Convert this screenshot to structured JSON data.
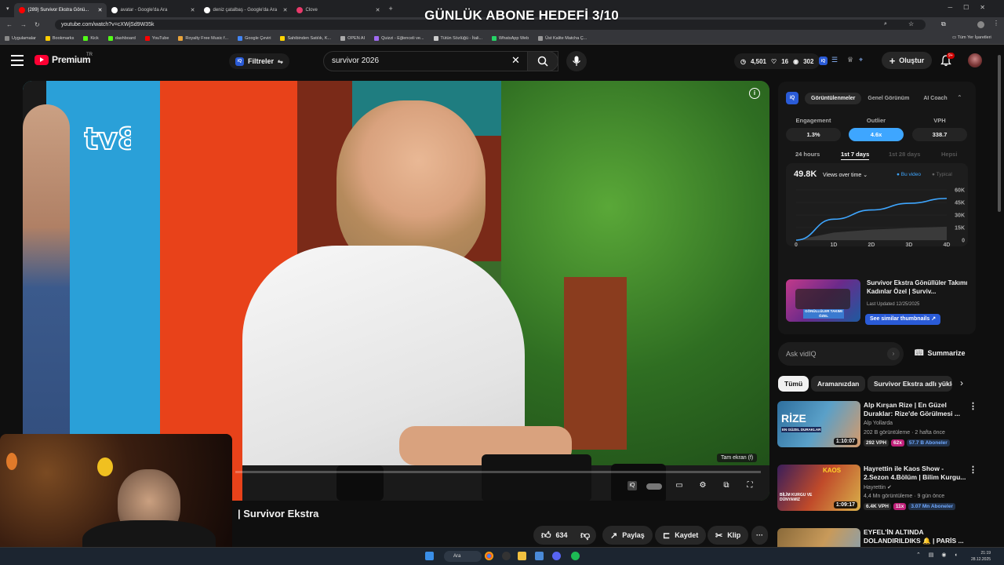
{
  "overlay_title": "GÜNLÜK ABONE HEDEFİ 3/10",
  "tabs": [
    {
      "label": "(289) Survivor Ekstra Gönü...",
      "color": "#ff0000",
      "active": true
    },
    {
      "label": "avatar - Google'da Ara",
      "color": "#ffffff",
      "active": false
    },
    {
      "label": "deniz çatalbaş - Google'da Ara",
      "color": "#ffffff",
      "active": false
    },
    {
      "label": "Clove",
      "color": "#e83a6b",
      "active": false
    }
  ],
  "address": {
    "url": "youtube.com/watch?v=cXWjSd9W35k"
  },
  "bookmarks": [
    "Uygulamalar",
    "Bookmarks",
    "Kick",
    "dashboard",
    "YouTube",
    "Royalty Free Music f...",
    "Google Çeviri",
    "Sahibinden Satılık, K...",
    "OPEN AI",
    "Quizzi - Eğlenceli ve...",
    "Tütün Sözlüğü - İtali...",
    "WhatsApp Web",
    "Üst Kalite Matcha Ç..."
  ],
  "bookmarks_right": "Tüm Yer İşaretleri",
  "header": {
    "logo": "Premium",
    "logo_country": "TR",
    "filters_label": "Filtreler",
    "search_value": "survivor 2026",
    "stats": {
      "views": "4,501",
      "a": "16",
      "b": "302"
    },
    "create_label": "Oluştur",
    "notifications": "9+"
  },
  "video": {
    "fullscreen_tip": "Tam ekran (f)",
    "title": "| Survivor Ekstra"
  },
  "actions": {
    "likes": "634",
    "share": "Paylaş",
    "save": "Kaydet",
    "clip": "Klip"
  },
  "vidiq": {
    "tabs": [
      "Görüntülenmeler",
      "Genel Görünüm",
      "AI Coach"
    ],
    "metrics": [
      {
        "label": "Engagement",
        "value": "1.3%"
      },
      {
        "label": "Outlier",
        "value": "4.6x"
      },
      {
        "label": "VPH",
        "value": "338.7"
      }
    ],
    "periods": [
      "24 hours",
      "1st 7 days",
      "1st 28 days",
      "Hepsi"
    ],
    "views_total": "49.8K",
    "views_dropdown": "Views over time",
    "legend": [
      "Bu video",
      "Typical"
    ],
    "chart_data": {
      "type": "area",
      "x": [
        "0",
        "1D",
        "2D",
        "3D",
        "4D"
      ],
      "yticks": [
        "0",
        "15K",
        "30K",
        "45K",
        "60K"
      ],
      "ylim": [
        0,
        60000
      ],
      "series": [
        {
          "name": "Bu video",
          "values": [
            0,
            25000,
            36000,
            44000,
            49800
          ]
        },
        {
          "name": "Typical",
          "values": [
            0,
            9000,
            12500,
            14500,
            16000
          ]
        }
      ]
    },
    "similar": {
      "title": "Survivor Ekstra Gönüllüler Takımı Kadınlar Özel | Surviv...",
      "updated": "Last Updated 12/25/2025",
      "button": "See similar thumbnails",
      "thumb_text": "GÖNÜLLÜLER TAKIMI ÖZEL"
    }
  },
  "ask": {
    "placeholder": "Ask vidIQ",
    "summarize": "Summarize"
  },
  "chips": [
    "Tümü",
    "Aramanızdan",
    "Survivor Ekstra adlı yükle"
  ],
  "related": [
    {
      "title": "Alp Kırşan Rize | En Güzel Duraklar: Rize'de Görülmesi ...",
      "channel": "Alp Yollarda",
      "meta": "202 B görüntüleme · 2 hafta önce",
      "vph": "292 VPH",
      "mult": "62x",
      "subs": "57.7 B Aboneler",
      "duration": "1:10:07",
      "thumb_text": "RİZE",
      "thumb_sub": "EN GÜZEL DURAKLAR"
    },
    {
      "title": "Hayrettin ile Kaos Show - 2.Sezon 4.Bölüm | Bilim Kurgu...",
      "channel": "Hayrettin",
      "meta": "4,4 Mn görüntüleme · 9 gün önce",
      "vph": "6.4K VPH",
      "mult": "11x",
      "subs": "3.07 Mn Aboneler",
      "duration": "1:09:17",
      "thumb_text": "KAOS",
      "thumb_sub": "BİLİM KURGU VE DÜNYAMIZ"
    },
    {
      "title": "EYFEL'İN ALTINDA DOLANDIRILDIKS 🔔 | PARİS ...",
      "channel": "",
      "meta": "",
      "vph": "",
      "mult": "",
      "subs": "",
      "duration": "",
      "thumb_text": "",
      "thumb_sub": ""
    }
  ],
  "taskbar": {
    "search": "Ara",
    "time": "21:19",
    "date": "28.12.2025"
  },
  "colors": {
    "accent": "#3ea6ff",
    "yt_red": "#ff0033",
    "vidiq_blue": "#2a5bd7"
  }
}
